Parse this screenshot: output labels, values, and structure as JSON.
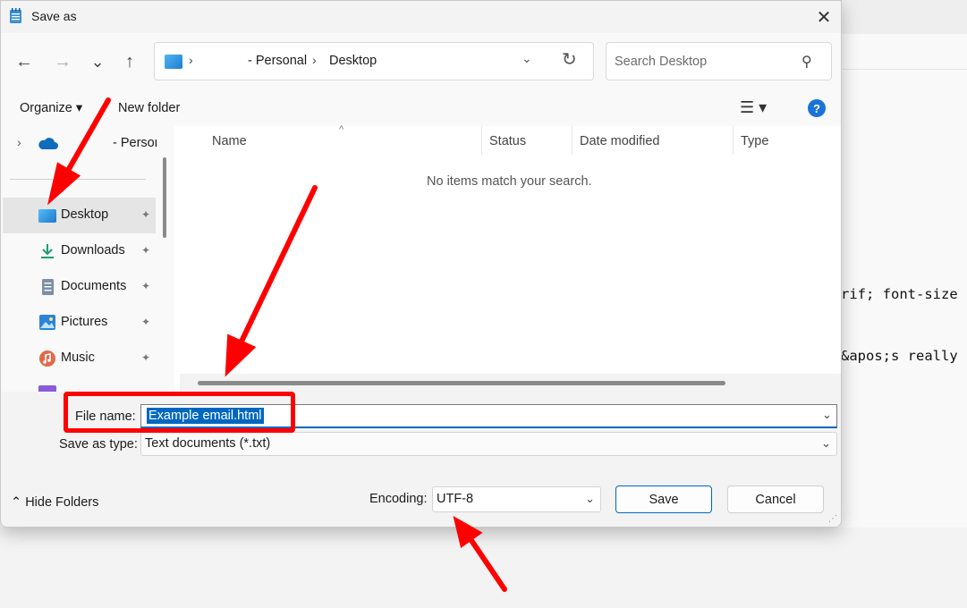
{
  "background_editor": {
    "code_lines": [
      "rif; font-size",
      "&apos;s really"
    ]
  },
  "dialog": {
    "title": "Save as",
    "close_glyph": "✕",
    "nav": {
      "back_glyph": "←",
      "forward_glyph": "→",
      "recent_glyph": "⌄",
      "up_glyph": "↑"
    },
    "address": {
      "segments": [
        "- Personal",
        "Desktop"
      ],
      "chevron": "›",
      "dropdown_glyph": "⌄",
      "refresh_glyph": "↻"
    },
    "search": {
      "placeholder": "Search Desktop",
      "icon_glyph": "⚲"
    },
    "toolbar": {
      "organize": "Organize ▾",
      "new_folder": "New folder",
      "view_glyph": "☰ ▾",
      "help_glyph": "?"
    },
    "nav_pane": {
      "onedrive": {
        "chevron": "›",
        "label": "- Persona"
      },
      "items": [
        {
          "label": "Desktop",
          "icon": "desktop-icon",
          "color": "#2f95e0"
        },
        {
          "label": "Downloads",
          "icon": "download-icon",
          "color": "#1f9e6e"
        },
        {
          "label": "Documents",
          "icon": "documents-icon",
          "color": "#6f7f94"
        },
        {
          "label": "Pictures",
          "icon": "pictures-icon",
          "color": "#2b83d9"
        },
        {
          "label": "Music",
          "icon": "music-icon",
          "color": "#e06a4a"
        }
      ],
      "pin_glyph": "📌"
    },
    "columns": [
      "Name",
      "Status",
      "Date modified",
      "Type"
    ],
    "empty_message": "No items match your search.",
    "file_name_label": "File name:",
    "file_name_value": "Example email.html",
    "save_as_type_label": "Save as type:",
    "save_as_type_value": "Text documents (*.txt)",
    "hide_folders": "Hide Folders",
    "hide_folders_glyph": "⌃",
    "encoding_label": "Encoding:",
    "encoding_value": "UTF-8",
    "save_button": "Save",
    "cancel_button": "Cancel"
  },
  "colors": {
    "accent": "#0067c0",
    "annotation": "#ff0000"
  }
}
